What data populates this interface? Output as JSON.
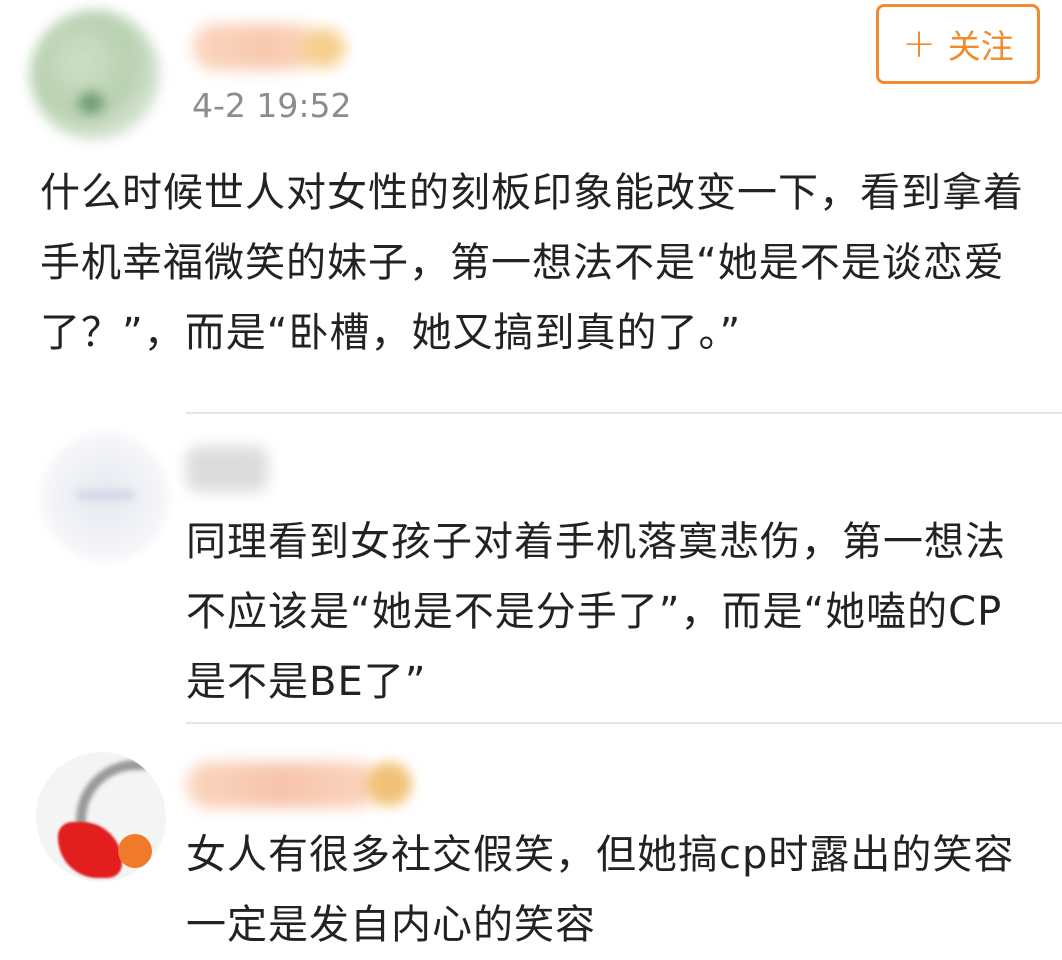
{
  "post": {
    "time": "4-2 19:52",
    "follow_label": "关注",
    "follow_icon": "plus-icon",
    "text": "什么时候世人对女性的刻板印象能改变一下，看到拿着手机幸福微笑的妹子，第一想法不是“她是不是谈恋爱了？”，而是“卧槽，她又搞到真的了。”"
  },
  "comments": [
    {
      "text": "同理看到女孩子对着手机落寞悲伤，第一想法不应该是“她是不是分手了”，而是“她嗑的CP是不是BE了”"
    },
    {
      "text": "女人有很多社交假笑，但她搞cp时露出的笑容一定是发自内心的笑容"
    }
  ],
  "colors": {
    "accent": "#f08c2f",
    "text": "#222222",
    "time": "#8c8c8c",
    "divider": "#e6e6e6"
  }
}
